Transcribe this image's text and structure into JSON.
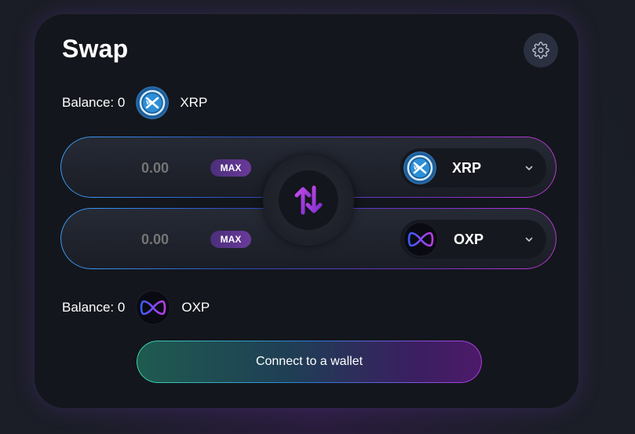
{
  "swap": {
    "title": "Swap",
    "settings_icon": "gear-icon",
    "top_balance": {
      "label": "Balance: 0",
      "token": "XRP",
      "icon": "xrp-coin-icon"
    },
    "from_row": {
      "amount_placeholder": "0.00",
      "max_label": "MAX",
      "token": "XRP",
      "token_icon": "xrp-coin-icon",
      "chevron_icon": "chevron-down-icon"
    },
    "to_row": {
      "amount_placeholder": "0.00",
      "max_label": "MAX",
      "token": "OXP",
      "token_icon": "oxp-coin-icon",
      "chevron_icon": "chevron-down-icon"
    },
    "flip_icon": "swap-arrows-icon",
    "bottom_balance": {
      "label": "Balance: 0",
      "token": "OXP",
      "icon": "oxp-coin-icon"
    },
    "connect_label": "Connect to a wallet"
  },
  "colors": {
    "card_bg": "#13161c",
    "accent_purple": "#a03ae0",
    "accent_teal": "#35d7b0",
    "accent_blue": "#3aa3ff"
  }
}
